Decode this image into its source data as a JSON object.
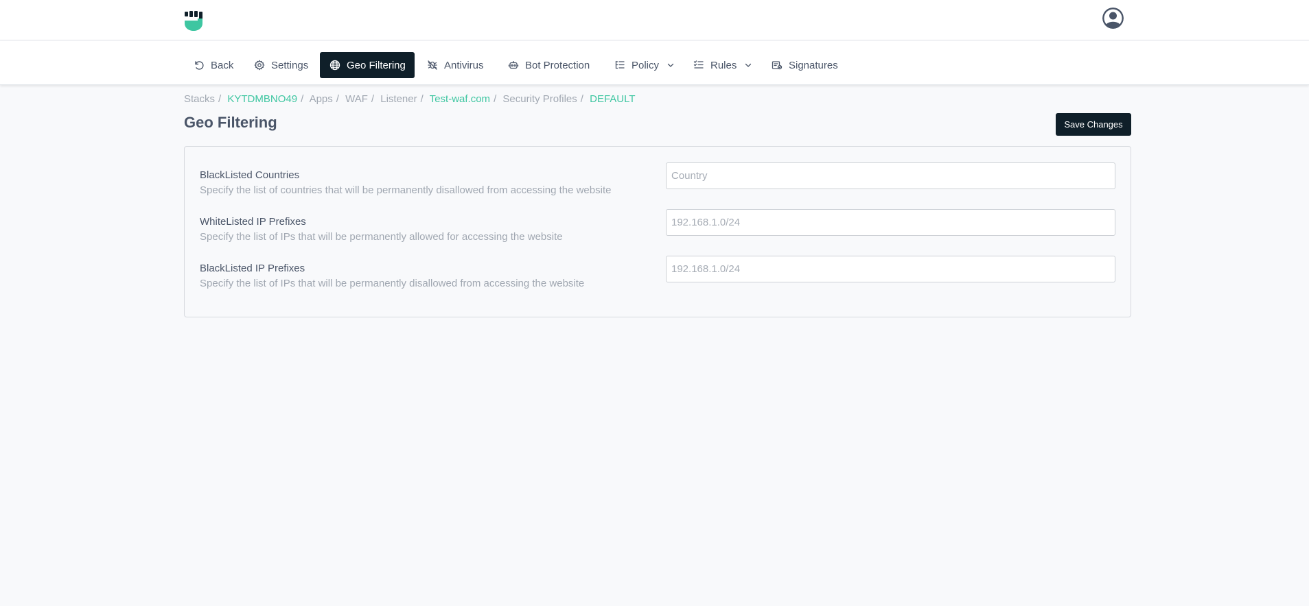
{
  "nav": {
    "items": [
      {
        "label": "Back",
        "icon": "undo-icon"
      },
      {
        "label": "Settings",
        "icon": "gear-icon"
      },
      {
        "label": "Geo Filtering",
        "icon": "globe-icon",
        "active": true
      },
      {
        "label": "Antivirus",
        "icon": "bug-off-icon"
      },
      {
        "label": "Bot Protection",
        "icon": "robot-icon"
      },
      {
        "label": "Policy",
        "icon": "list-tree-icon",
        "dropdown": true
      },
      {
        "label": "Rules",
        "icon": "list-check-icon",
        "dropdown": true
      },
      {
        "label": "Signatures",
        "icon": "signature-icon"
      }
    ]
  },
  "breadcrumb": [
    {
      "label": "Stacks",
      "link": false
    },
    {
      "label": "KYTDMBNO49",
      "link": true
    },
    {
      "label": "Apps",
      "link": false
    },
    {
      "label": "WAF",
      "link": false
    },
    {
      "label": "Listener",
      "link": false
    },
    {
      "label": "Test-waf.com",
      "link": true
    },
    {
      "label": "Security Profiles",
      "link": false
    },
    {
      "label": "DEFAULT",
      "link": true
    }
  ],
  "page": {
    "title": "Geo Filtering",
    "save_label": "Save Changes"
  },
  "form": {
    "rows": [
      {
        "label": "BlackListed Countries",
        "description": "Specify the list of countries that will be permanently disallowed from accessing the website",
        "value": "",
        "placeholder": "Country"
      },
      {
        "label": "WhiteListed IP Prefixes",
        "description": "Specify the list of IPs that will be permanently allowed for accessing the website",
        "value": "",
        "placeholder": "192.168.1.0/24"
      },
      {
        "label": "BlackListed IP Prefixes",
        "description": "Specify the list of IPs that will be permanently disallowed from accessing the website",
        "value": "",
        "placeholder": "192.168.1.0/24"
      }
    ]
  },
  "colors": {
    "accent": "#3ec6a1",
    "dark": "#0f1f29"
  }
}
